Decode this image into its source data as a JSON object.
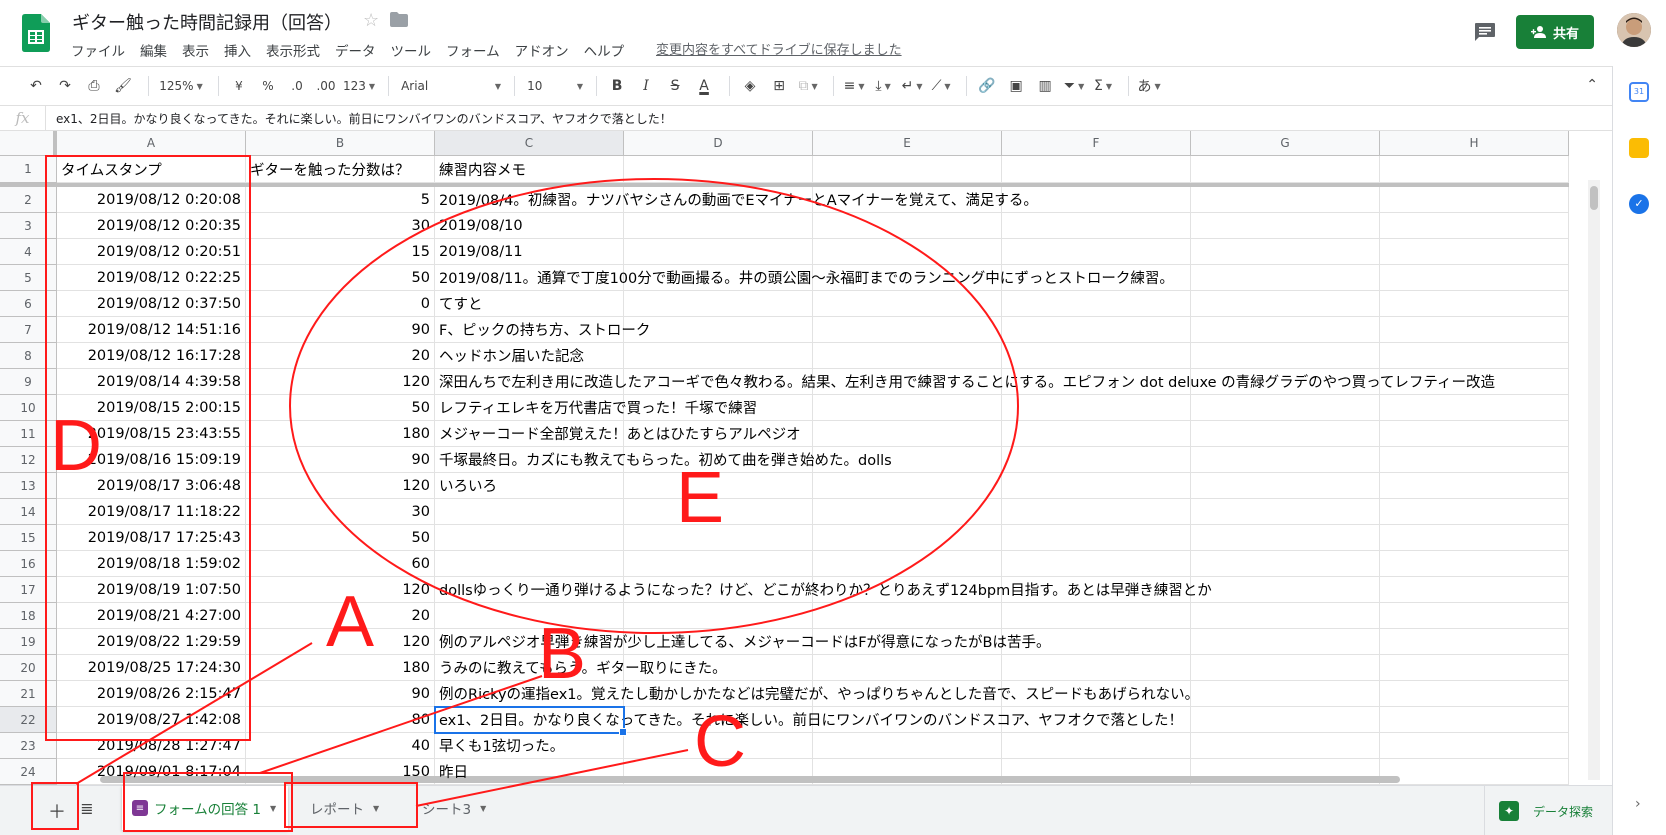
{
  "app": {
    "title": "ギター触った時間記録用（回答）",
    "menu": [
      "ファイル",
      "編集",
      "表示",
      "挿入",
      "表示形式",
      "データ",
      "ツール",
      "フォーム",
      "アドオン",
      "ヘルプ"
    ],
    "save_status": "変更内容をすべてドライブに保存しました",
    "share_label": "共有"
  },
  "toolbar": {
    "zoom": "125%",
    "currency": "¥",
    "percent": "%",
    "dec_decrease": ".0",
    "dec_increase": ".00",
    "more_formats": "123",
    "font": "Arial",
    "font_size": "10",
    "bold": "B",
    "italic": "I",
    "strike": "S",
    "text_color": "A",
    "input_tools": "あ"
  },
  "formula_bar": {
    "fx": "fx",
    "content": "ex1、2日目。かなり良くなってきた。それに楽しい。前日にワンバイワンのバンドスコア、ヤフオクで落とした！"
  },
  "grid": {
    "columns": [
      "A",
      "B",
      "C",
      "D",
      "E",
      "F",
      "G",
      "H"
    ],
    "selected_column": "C",
    "selected_row": "22",
    "header_row": {
      "number": "1",
      "cells": [
        "タイムスタンプ",
        "ギターを触った分数は？",
        "練習内容メモ"
      ]
    },
    "rows": [
      {
        "n": "2",
        "a": "2019/08/12 0:20:08",
        "b": "5",
        "c": "2019/08/4。初練習。ナツバヤシさんの動画でEマイナーとAマイナーを覚えて、満足する。"
      },
      {
        "n": "3",
        "a": "2019/08/12 0:20:35",
        "b": "30",
        "c": "2019/08/10"
      },
      {
        "n": "4",
        "a": "2019/08/12 0:20:51",
        "b": "15",
        "c": "2019/08/11"
      },
      {
        "n": "5",
        "a": "2019/08/12 0:22:25",
        "b": "50",
        "c": "2019/08/11。通算で丁度100分で動画撮る。井の頭公園〜永福町までのランニング中にずっとストローク練習。"
      },
      {
        "n": "6",
        "a": "2019/08/12 0:37:50",
        "b": "0",
        "c": "てすと"
      },
      {
        "n": "7",
        "a": "2019/08/12 14:51:16",
        "b": "90",
        "c": "F、ピックの持ち方、ストローク"
      },
      {
        "n": "8",
        "a": "2019/08/12 16:17:28",
        "b": "20",
        "c": "ヘッドホン届いた記念"
      },
      {
        "n": "9",
        "a": "2019/08/14 4:39:58",
        "b": "120",
        "c": "深田んちで左利き用に改造したアコーギで色々教わる。結果、左利き用で練習することにする。エピフォン dot deluxe の青緑グラデのやつ買ってレフティー改造"
      },
      {
        "n": "10",
        "a": "2019/08/15 2:00:15",
        "b": "50",
        "c": "レフティエレキを万代書店で買った！千塚で練習"
      },
      {
        "n": "11",
        "a": "2019/08/15 23:43:55",
        "b": "180",
        "c": "メジャーコード全部覚えた！あとはひたすらアルペジオ"
      },
      {
        "n": "12",
        "a": "2019/08/16 15:09:19",
        "b": "90",
        "c": "千塚最終日。カズにも教えてもらった。初めて曲を弾き始めた。dolls"
      },
      {
        "n": "13",
        "a": "2019/08/17 3:06:48",
        "b": "120",
        "c": "いろいろ"
      },
      {
        "n": "14",
        "a": "2019/08/17 11:18:22",
        "b": "30",
        "c": ""
      },
      {
        "n": "15",
        "a": "2019/08/17 17:25:43",
        "b": "50",
        "c": ""
      },
      {
        "n": "16",
        "a": "2019/08/18 1:59:02",
        "b": "60",
        "c": ""
      },
      {
        "n": "17",
        "a": "2019/08/19 1:07:50",
        "b": "120",
        "c": "dollsゆっくり一通り弾けるようになった？けど、どこが終わりか？とりあえず124bpm目指す。あとは早弾き練習とか"
      },
      {
        "n": "18",
        "a": "2019/08/21 4:27:00",
        "b": "20",
        "c": ""
      },
      {
        "n": "19",
        "a": "2019/08/22 1:29:59",
        "b": "120",
        "c": "例のアルペジオ早弾き練習が少し上達してる、メジャーコードはFが得意になったがBは苦手。"
      },
      {
        "n": "20",
        "a": "2019/08/25 17:24:30",
        "b": "180",
        "c": "うみのに教えてもらう。ギター取りにきた。"
      },
      {
        "n": "21",
        "a": "2019/08/26 2:15:47",
        "b": "90",
        "c": "例のRickyの運指ex1。覚えたし動かしかたなどは完璧だが、やっぱりちゃんとした音で、スピードもあげられない。"
      },
      {
        "n": "22",
        "a": "2019/08/27 1:42:08",
        "b": "80",
        "c": "ex1、2日目。かなり良くなってきた。それに楽しい。前日にワンバイワンのバンドスコア、ヤフオクで落とした！"
      },
      {
        "n": "23",
        "a": "2019/08/28 1:27:47",
        "b": "40",
        "c": "早くも1弦切った。"
      },
      {
        "n": "24",
        "a": "2019/09/01 8:17:04",
        "b": "150",
        "c": "昨日"
      }
    ]
  },
  "sheet_tabs": [
    {
      "label": "フォームの回答 1",
      "active": true
    },
    {
      "label": "レポート",
      "active": false
    },
    {
      "label": "シート3",
      "active": false
    }
  ],
  "explore_label": "データ探索",
  "annotations": {
    "labels": [
      "A",
      "B",
      "C",
      "D",
      "E"
    ],
    "color": "#ff1a1a"
  },
  "colors": {
    "brand_green": "#188038",
    "selection_blue": "#1a73e8",
    "annotation_red": "#ff1a1a"
  }
}
